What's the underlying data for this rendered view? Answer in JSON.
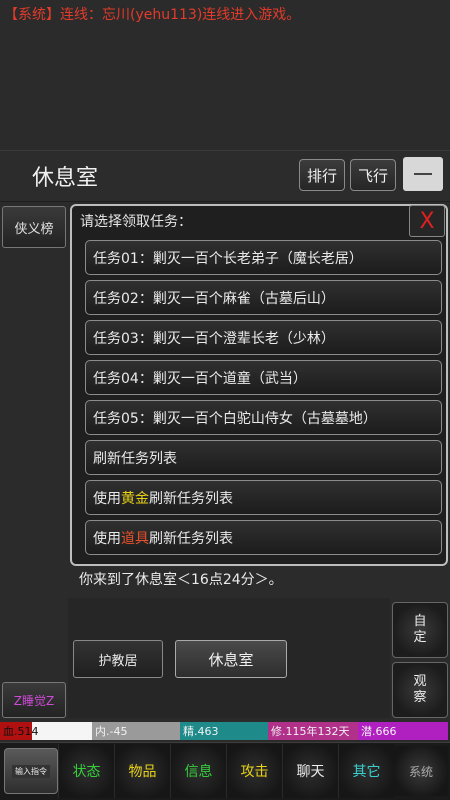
{
  "system_message": "【系统】连线：忘川(yehu113)连线进入游戏。",
  "header": {
    "room_title": "休息室",
    "rank_button": "排行",
    "fly_button": "飞行"
  },
  "left": {
    "hero_rank_button": "侠义榜",
    "z_button": "Z睡觉Z"
  },
  "task_panel": {
    "title": "请选择领取任务：",
    "close_label": "X",
    "tasks": [
      "任务01：剿灭一百个长老弟子（魔长老居）",
      "任务02：剿灭一百个麻雀（古墓后山）",
      "任务03：剿灭一百个澄辈长老（少林）",
      "任务04：剿灭一百个道童（武当）",
      "任务05：剿灭一百个白驼山侍女（古墓墓地）"
    ],
    "refresh": "刷新任务列表",
    "gold_refresh": {
      "prefix": "使用",
      "highlight": "黄金",
      "suffix": "刷新任务列表"
    },
    "item_refresh": {
      "prefix": "使用",
      "highlight": "道具",
      "suffix": "刷新任务列表"
    }
  },
  "arrival_message": "你来到了休息室＜16点24分＞。",
  "exits": {
    "left": "护教居",
    "current": "休息室"
  },
  "side_buttons": {
    "custom": "自定",
    "observe": "观察"
  },
  "stats": [
    {
      "label": "血.514",
      "color": "#b01010",
      "fill": 0.35
    },
    {
      "label": "内.-45",
      "color": "#9a9a9a",
      "fill": 1.0
    },
    {
      "label": "精.463",
      "color": "#1f8a8a",
      "fill": 1.0
    },
    {
      "label": "修.115年132天",
      "color": "#b0308a",
      "fill": 1.0
    },
    {
      "label": "潜.666",
      "color": "#b020c0",
      "fill": 1.0
    }
  ],
  "nav": {
    "input_label": "输入指令",
    "tabs": [
      {
        "label": "状态",
        "color": "#34d03a"
      },
      {
        "label": "物品",
        "color": "#e8d217"
      },
      {
        "label": "信息",
        "color": "#34d03a"
      },
      {
        "label": "攻击",
        "color": "#e8d217"
      },
      {
        "label": "聊天",
        "color": "#eeeeee"
      },
      {
        "label": "其它",
        "color": "#3ad0d0"
      }
    ],
    "settings_label": "系统"
  }
}
